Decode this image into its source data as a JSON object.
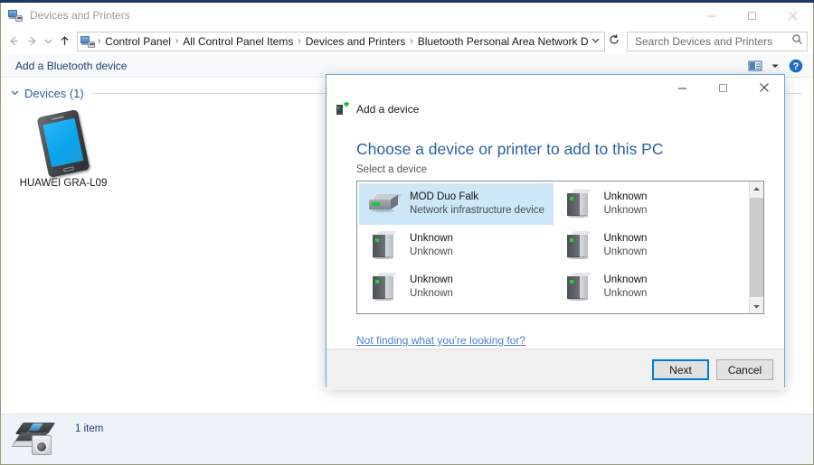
{
  "window": {
    "title": "Devices and Printers",
    "title_icon": "devices-and-printers-icon",
    "minimize_label": "Minimize",
    "maximize_label": "Maximize",
    "close_label": "Close"
  },
  "navigation": {
    "back_label": "Back",
    "forward_label": "Forward",
    "recent_label": "Recent locations",
    "up_label": "Up",
    "breadcrumbs": [
      "Control Panel",
      "All Control Panel Items",
      "Devices and Printers",
      "Bluetooth Personal Area Network Devices"
    ],
    "separator": "›",
    "dropdown_icon": "chevron-down-icon",
    "refresh_icon": "refresh-icon"
  },
  "search": {
    "placeholder": "Search Devices and Printers",
    "value": "",
    "icon": "search-icon"
  },
  "command_bar": {
    "add_bluetooth_device": "Add a Bluetooth device",
    "view_icon": "view-layout-icon",
    "view_dropdown_icon": "chevron-down-icon",
    "help_icon": "help-icon"
  },
  "devices_group": {
    "chevron": "⌄",
    "title": "Devices (1)",
    "items": [
      {
        "label": "HUAWEI GRA-L09",
        "icon": "smartphone-icon"
      }
    ]
  },
  "status_bar": {
    "icon": "printer-camera-icon",
    "text": "1 item"
  },
  "dialog": {
    "title": "Add a device",
    "title_icon": "add-device-icon",
    "minimize_label": "Minimize",
    "maximize_label": "Maximize",
    "close_label": "Close",
    "heading": "Choose a device or printer to add to this PC",
    "subheading": "Select a device",
    "devices": [
      {
        "name": "MOD Duo Falk",
        "subtitle": "Network infrastructure device",
        "icon": "network-device-icon",
        "selected": true
      },
      {
        "name": "Unknown",
        "subtitle": "Unknown",
        "icon": "tower-pc-icon",
        "selected": false
      },
      {
        "name": "Unknown",
        "subtitle": "Unknown",
        "icon": "tower-pc-icon",
        "selected": false
      },
      {
        "name": "Unknown",
        "subtitle": "Unknown",
        "icon": "tower-pc-icon",
        "selected": false
      },
      {
        "name": "Unknown",
        "subtitle": "Unknown",
        "icon": "tower-pc-icon",
        "selected": false
      },
      {
        "name": "Unknown",
        "subtitle": "Unknown",
        "icon": "tower-pc-icon",
        "selected": false
      }
    ],
    "scrollbar": {
      "up_icon": "scroll-up-icon",
      "down_icon": "scroll-down-icon"
    },
    "link": "Not finding what you're looking for?",
    "next_button": "Next",
    "cancel_button": "Cancel"
  },
  "colors": {
    "accent_blue": "#0078d7",
    "heading_blue": "#2a5fa5",
    "link_blue": "#4b7fd6",
    "selection_blue": "#cce8f6",
    "dialog_border": "#6ba7d6"
  }
}
